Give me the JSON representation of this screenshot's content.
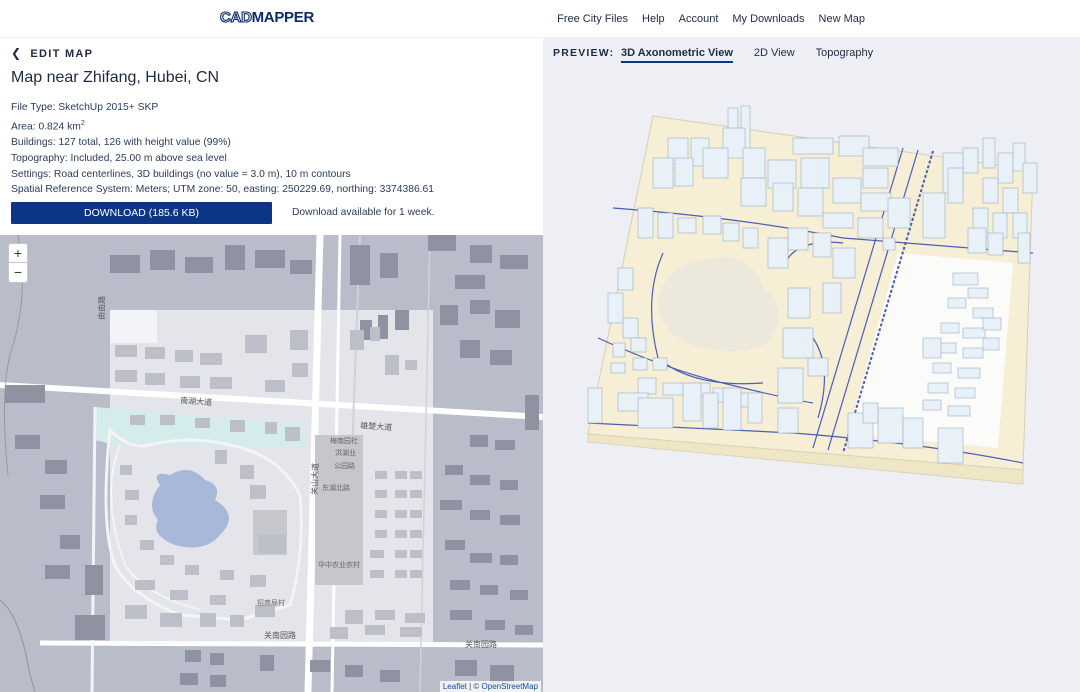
{
  "header": {
    "logo_part1": "CAD",
    "logo_part2": "MAPPER",
    "nav": [
      "Free City Files",
      "Help",
      "Account",
      "My Downloads",
      "New Map"
    ]
  },
  "left_panel": {
    "back_label": "EDIT MAP",
    "title": "Map near Zhifang, Hubei, CN",
    "info": {
      "file_type": "File Type: SketchUp 2015+ SKP",
      "area_prefix": "Area: 0.824 km",
      "area_sup": "2",
      "buildings": "Buildings: 127 total, 126 with height value (99%)",
      "topography": "Topography: Included, 25.00 m above sea level",
      "settings": "Settings: Road centerlines, 3D buildings (no value = 3.0 m), 10 m contours",
      "srs": "Spatial Reference System: Meters; UTM zone: 50, easting: 250229.69, northing: 3374386.61"
    },
    "download_label": "DOWNLOAD (185.6 KB)",
    "download_note": "Download available for 1 week.",
    "map": {
      "zoom_in": "+",
      "zoom_out": "−",
      "labels": {
        "road_west": "南湖大道",
        "road_mid": "雄楚大道",
        "road_vertical": "关山大道",
        "road_south": "关南园路",
        "road_south2": "关南园路",
        "road_north": "由由路",
        "poi1": "梅南园社",
        "poi2": "洪湖业",
        "poi3": "公园路",
        "poi4": "东湖北路",
        "poi5": "华中农业农村",
        "poi6": "招商局村"
      },
      "attribution_leaflet": "Leaflet",
      "attribution_sep": " | © ",
      "attribution_osm": "OpenStreetMap"
    }
  },
  "right_panel": {
    "preview_label": "PREVIEW:",
    "tabs": [
      "3D Axonometric View",
      "2D View",
      "Topography"
    ],
    "active_tab": 0
  },
  "colors": {
    "brand_navy": "#0c3584",
    "terrain": "#f5efd8",
    "building": "#e8f1f8",
    "road_line": "#3a4fa8",
    "map_dark": "#b9bcc9",
    "map_selection": "#e9eaee"
  }
}
